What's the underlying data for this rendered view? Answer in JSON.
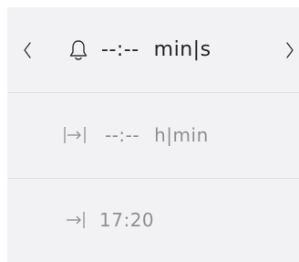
{
  "timer": {
    "value": "--:--",
    "unit": "min|s"
  },
  "duration": {
    "value": "--:--",
    "unit": "h|min"
  },
  "end_time": {
    "value": "17:20"
  },
  "icons": {
    "prev": "chevron-left-icon",
    "next": "chevron-right-icon",
    "timer": "bell-icon",
    "duration": "span-arrow-icon",
    "end": "arrow-to-bar-icon"
  },
  "colors": {
    "background": "#f2f2f4",
    "text_primary": "#222222",
    "text_muted": "#8e8e93"
  }
}
